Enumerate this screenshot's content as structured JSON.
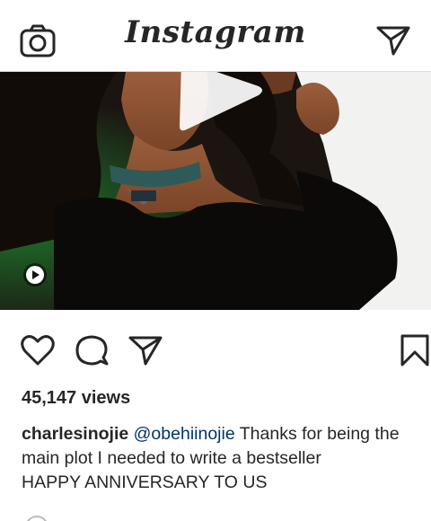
{
  "app": {
    "name": "Instagram"
  },
  "header": {
    "camera_icon": "camera-icon",
    "direct_icon": "paper-plane-icon"
  },
  "post": {
    "media_type": "video",
    "big_play_icon": "play-icon",
    "video_badge_icon": "video-play-icon",
    "views": "45,147 views",
    "caption": {
      "username": "charlesinojie",
      "mention": "@obehiinojie",
      "line1_text": "Thanks for being the",
      "line2_text": "main plot I needed to write a bestseller",
      "line3_text": "HAPPY ANNIVERSARY TO US"
    }
  },
  "actions": {
    "like_icon": "heart-icon",
    "comment_icon": "comment-icon",
    "share_icon": "paper-plane-icon",
    "save_icon": "bookmark-icon"
  },
  "colors": {
    "text": "#262626",
    "mention": "#003569",
    "divider": "#dbdbdb",
    "background": "#ffffff"
  }
}
